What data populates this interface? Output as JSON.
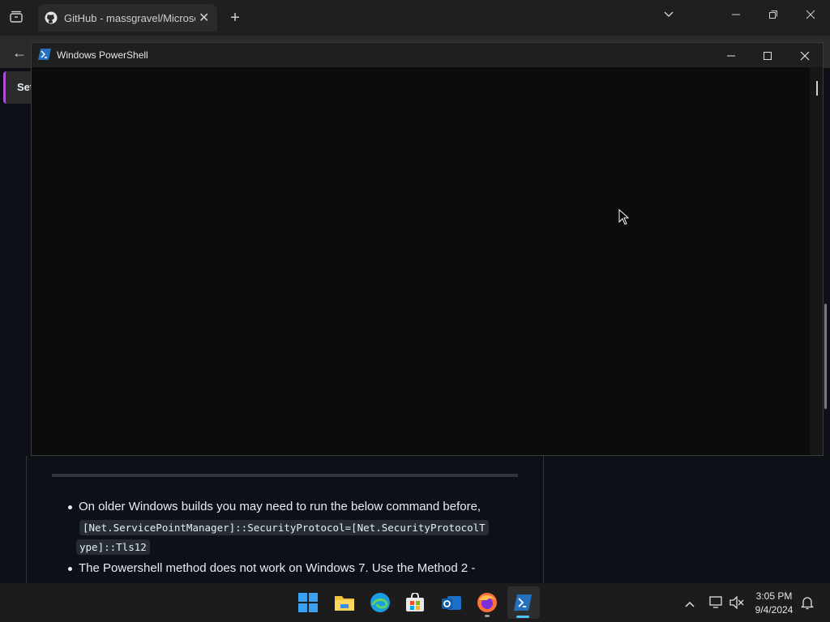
{
  "browser": {
    "tab_title": "GitHub - massgravel/Microsoft-Activation-Scripts",
    "settings_button_label": "Set"
  },
  "powershell": {
    "title": "Windows PowerShell"
  },
  "page": {
    "bullet1_text": "On older Windows builds you may need to run the below command before,",
    "bullet1_code_line1": "[Net.ServicePointManager]::SecurityProtocol=[Net.SecurityProtocolT",
    "bullet1_code_line2": "ype]::Tls12",
    "bullet2_text": "The Powershell method does not work on Windows 7. Use the Method 2 -"
  },
  "taskbar": {
    "time": "3:05 PM",
    "date": "9/4/2024",
    "apps": [
      "start",
      "file-explorer",
      "edge",
      "microsoft-store",
      "outlook",
      "firefox",
      "powershell"
    ]
  },
  "colors": {
    "powershell_blue": "#2671be",
    "accent": "#b04fd6"
  }
}
